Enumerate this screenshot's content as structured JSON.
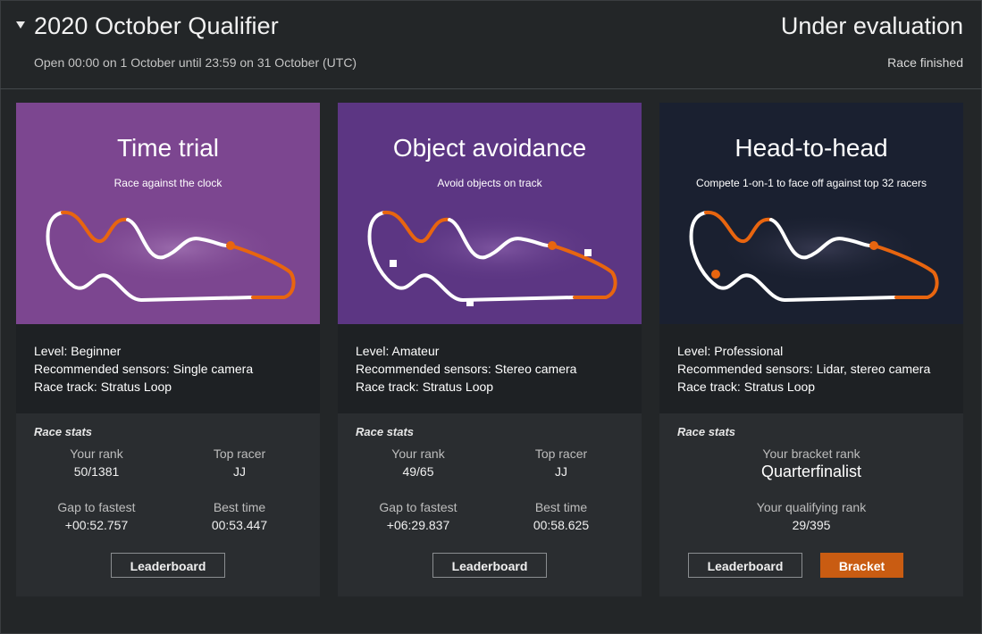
{
  "header": {
    "title": "2020 October Qualifier",
    "subtitle": "Open 00:00 on 1 October until 23:59 on 31 October (UTC)",
    "status": "Under evaluation",
    "substatus": "Race finished"
  },
  "cards": [
    {
      "title": "Time trial",
      "subtitle": "Race against the clock",
      "level": "Level: Beginner",
      "sensors": "Recommended sensors: Single camera",
      "track": "Race track: Stratus Loop",
      "stats_heading": "Race stats",
      "rank_label": "Your rank",
      "rank_value": "50/1381",
      "top_label": "Top racer",
      "top_value": "JJ",
      "gap_label": "Gap to fastest",
      "gap_value": "+00:52.757",
      "best_label": "Best time",
      "best_value": "00:53.447",
      "leaderboard_label": "Leaderboard"
    },
    {
      "title": "Object avoidance",
      "subtitle": "Avoid objects on track",
      "level": "Level: Amateur",
      "sensors": "Recommended sensors: Stereo camera",
      "track": "Race track: Stratus Loop",
      "stats_heading": "Race stats",
      "rank_label": "Your rank",
      "rank_value": "49/65",
      "top_label": "Top racer",
      "top_value": "JJ",
      "gap_label": "Gap to fastest",
      "gap_value": "+06:29.837",
      "best_label": "Best time",
      "best_value": "00:58.625",
      "leaderboard_label": "Leaderboard"
    },
    {
      "title": "Head-to-head",
      "subtitle": "Compete 1-on-1 to face off against top 32 racers",
      "level": "Level: Professional",
      "sensors": "Recommended sensors: Lidar, stereo camera",
      "track": "Race track: Stratus Loop",
      "stats_heading": "Race stats",
      "bracket_rank_label": "Your bracket rank",
      "bracket_rank_value": "Quarterfinalist",
      "qual_rank_label": "Your qualifying rank",
      "qual_rank_value": "29/395",
      "leaderboard_label": "Leaderboard",
      "bracket_label": "Bracket"
    }
  ],
  "colors": {
    "accent": "#e8650f",
    "button_orange": "#c95c12",
    "hero_time_trial": "#7c4690",
    "hero_object_avoidance": "#5c3683",
    "hero_head_to_head": "#1a2030"
  },
  "icons": {
    "collapse": "caret-down-icon",
    "track": "race-track-icon"
  }
}
